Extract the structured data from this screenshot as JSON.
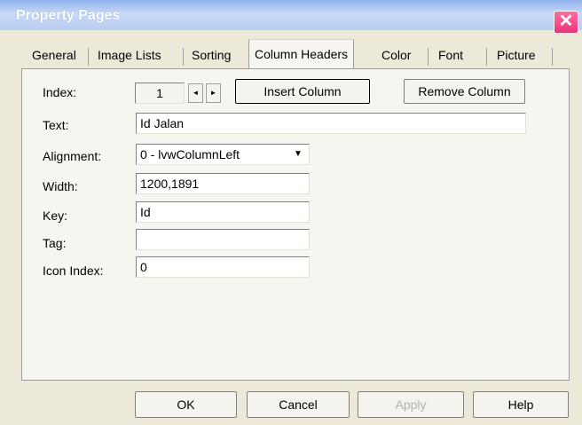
{
  "window": {
    "title": "Property Pages"
  },
  "titlebar": {
    "close_symbol": "✕"
  },
  "tabs": [
    {
      "label": "General"
    },
    {
      "label": "Image Lists"
    },
    {
      "label": "Sorting"
    },
    {
      "label": "Column Headers",
      "active": true
    },
    {
      "label": "Color"
    },
    {
      "label": "Font"
    },
    {
      "label": "Picture"
    }
  ],
  "index": {
    "label": "Index:",
    "value": "1",
    "spin_left": "◄",
    "spin_right": "►",
    "insert_button": "Insert Column",
    "remove_button": "Remove Column"
  },
  "text": {
    "label": "Text:",
    "value": "Id Jalan"
  },
  "alignment": {
    "label": "Alignment:",
    "value": "0 - lvwColumnLeft",
    "arrow": "▼"
  },
  "width": {
    "label": "Width:",
    "value": "1200,1891"
  },
  "key": {
    "label": "Key:",
    "value": "Id"
  },
  "tag": {
    "label": "Tag:",
    "value": ""
  },
  "icon_index": {
    "label": "Icon Index:",
    "value": "0"
  },
  "footer": {
    "ok": "OK",
    "cancel": "Cancel",
    "apply": "Apply",
    "help": "Help"
  }
}
